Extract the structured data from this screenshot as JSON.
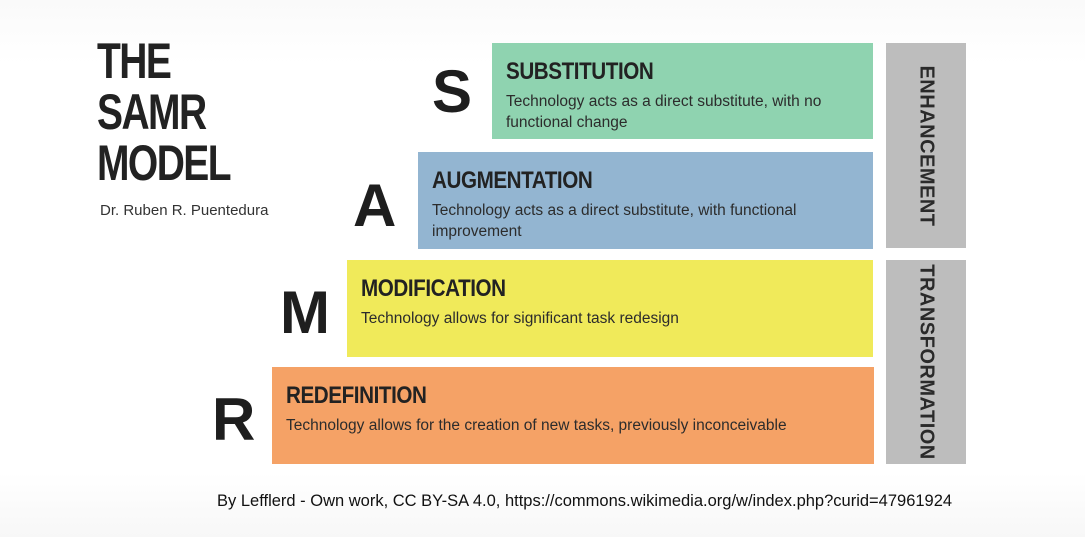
{
  "title": {
    "line1": "THE",
    "line2": "SAMR",
    "line3": "MODEL"
  },
  "author": "Dr. Ruben R. Puentedura",
  "levels": [
    {
      "letter": "S",
      "name": "SUBSTITUTION",
      "description": "Technology acts as a direct substitute, with no functional change",
      "color": "#8fd3b0"
    },
    {
      "letter": "A",
      "name": "AUGMENTATION",
      "description": "Technology acts as a direct substitute, with functional improvement",
      "color": "#93b5d1"
    },
    {
      "letter": "M",
      "name": "MODIFICATION",
      "description": "Technology allows for significant task redesign",
      "color": "#f0ea5a"
    },
    {
      "letter": "R",
      "name": "REDEFINITION",
      "description": "Technology allows for the creation of new tasks, previously inconceivable",
      "color": "#f5a266"
    }
  ],
  "groups": [
    {
      "label": "ENHANCEMENT",
      "color": "#bdbdbd"
    },
    {
      "label": "TRANSFORMATION",
      "color": "#bdbdbd"
    }
  ],
  "credit": "By Lefflerd - Own work, CC BY-SA 4.0, https://commons.wikimedia.org/w/index.php?curid=47961924"
}
